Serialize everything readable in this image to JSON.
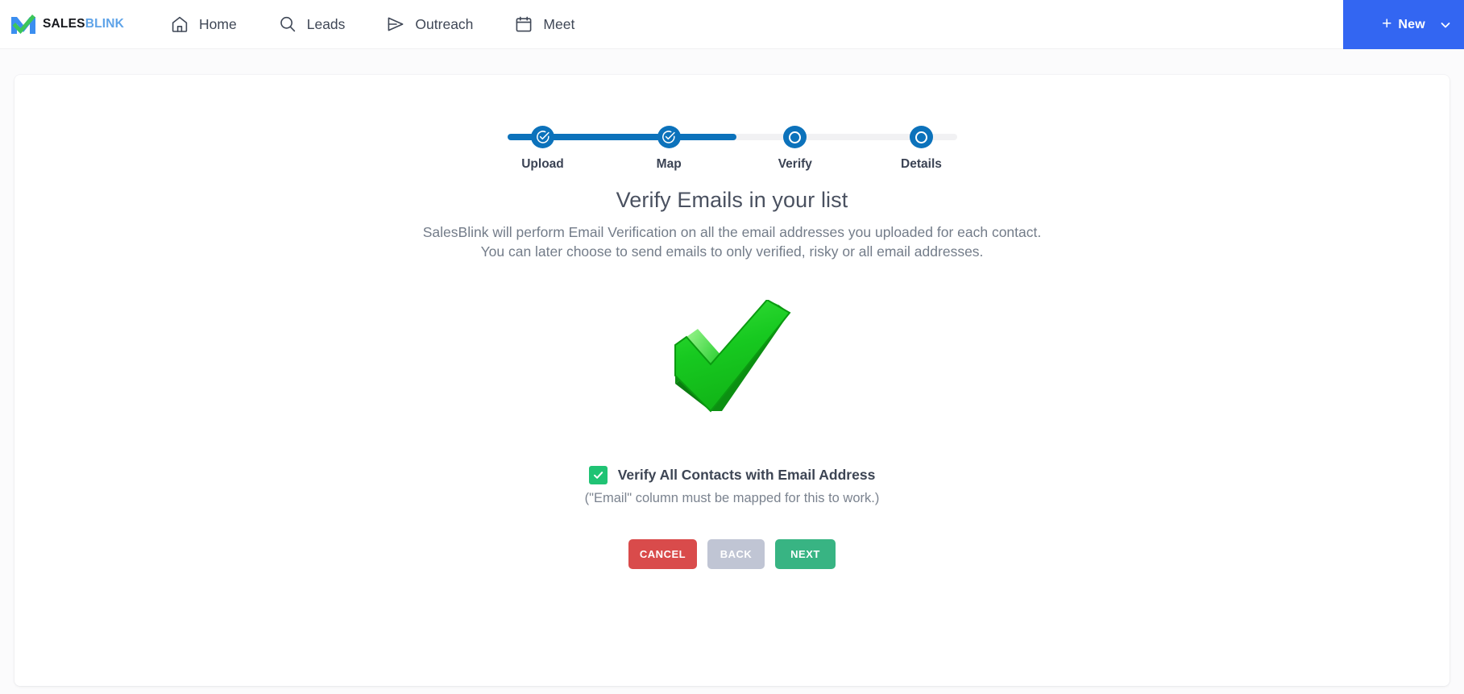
{
  "brand": {
    "name_part1": "SALES",
    "name_part2": "BLINK",
    "logo_icon": "salesblink-check-logo",
    "accent_blue": "#3366f2",
    "accent_green": "#20c374"
  },
  "nav": {
    "items": [
      {
        "label": "Home",
        "icon": "home-icon"
      },
      {
        "label": "Leads",
        "icon": "search-icon"
      },
      {
        "label": "Outreach",
        "icon": "paper-plane-icon"
      },
      {
        "label": "Meet",
        "icon": "calendar-icon"
      }
    ],
    "new_button": {
      "label": "New",
      "plus_icon": "plus-icon",
      "chevron_icon": "chevron-down-icon",
      "color": "#3366f2"
    }
  },
  "stepper": {
    "active_index": 2,
    "progress_color": "#0c72bb",
    "track_color": "#f1f1f3",
    "steps": [
      {
        "label": "Upload",
        "state": "complete",
        "icon": "check-circle-icon"
      },
      {
        "label": "Map",
        "state": "complete",
        "icon": "check-circle-icon"
      },
      {
        "label": "Verify",
        "state": "current",
        "icon": "ring-icon"
      },
      {
        "label": "Details",
        "state": "upcoming",
        "icon": "ring-icon"
      }
    ]
  },
  "main": {
    "heading": "Verify Emails in your list",
    "description_line1": "SalesBlink will perform Email Verification on all the email addresses you uploaded for each contact.",
    "description_line2": "You can later choose to send emails to only verified, risky or all email addresses.",
    "hero_icon": "green-checkmark-3d",
    "checkbox": {
      "checked": true,
      "label": "Verify All Contacts with Email Address",
      "note": "(\"Email\" column must be mapped for this to work.)",
      "color": "#20c374"
    },
    "buttons": {
      "cancel": {
        "label": "CANCEL",
        "color": "#d94b4b"
      },
      "back": {
        "label": "BACK",
        "color": "#c0c5d4",
        "disabled": true
      },
      "next": {
        "label": "NEXT",
        "color": "#38b483"
      }
    }
  }
}
